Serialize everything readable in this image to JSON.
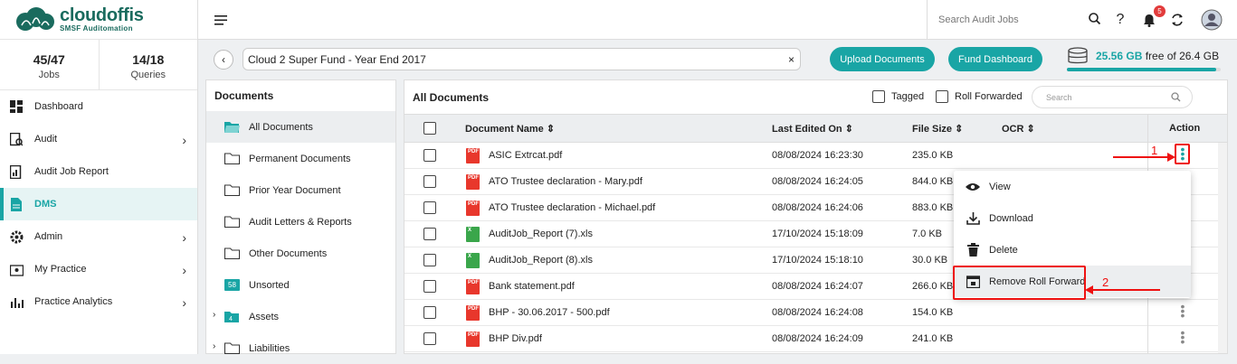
{
  "brand": {
    "title": "cloudoffis",
    "subtitle": "SMSF Auditomation"
  },
  "stats": [
    {
      "value": "45/47",
      "label": "Jobs"
    },
    {
      "value": "14/18",
      "label": "Queries"
    }
  ],
  "nav": [
    {
      "label": "Dashboard",
      "icon": "dashboard-icon"
    },
    {
      "label": "Audit",
      "icon": "audit-icon"
    },
    {
      "label": "Audit Job Report",
      "icon": "report-icon"
    },
    {
      "label": "DMS",
      "icon": "document-icon"
    },
    {
      "label": "Admin",
      "icon": "gear-icon"
    },
    {
      "label": "My Practice",
      "icon": "practice-icon"
    },
    {
      "label": "Practice Analytics",
      "icon": "analytics-icon"
    }
  ],
  "topbar": {
    "search_placeholder": "Search Audit Jobs",
    "notification_count": "5"
  },
  "path": {
    "value": "Cloud 2 Super Fund - Year End 2017",
    "clear": "×"
  },
  "buttons": {
    "upload": "Upload Documents",
    "fund": "Fund Dashboard"
  },
  "storage": {
    "used": "25.56 GB",
    "rest": " free of 26.4 GB",
    "fraction": 0.97
  },
  "folders": {
    "title": "Documents",
    "items": [
      {
        "label": "All Documents"
      },
      {
        "label": "Permanent Documents"
      },
      {
        "label": "Prior Year Document"
      },
      {
        "label": "Audit Letters & Reports"
      },
      {
        "label": "Other Documents"
      },
      {
        "label": "Unsorted",
        "count": "58"
      },
      {
        "label": "Assets"
      },
      {
        "label": "Liabilities"
      }
    ]
  },
  "docs": {
    "title": "All Documents",
    "filter_tagged": "Tagged",
    "filter_rolled": "Roll Forwarded",
    "search_placeholder": "Search",
    "columns": {
      "name": "Document Name",
      "edited": "Last Edited On",
      "size": "File Size",
      "ocr": "OCR",
      "action": "Action"
    },
    "rows": [
      {
        "name": "ASIC Extrcat.pdf",
        "edited": "08/08/2024 16:23:30",
        "size": "235.0 KB",
        "type": "pdf"
      },
      {
        "name": "ATO Trustee declaration - Mary.pdf",
        "edited": "08/08/2024 16:24:05",
        "size": "844.0 KB",
        "type": "pdf"
      },
      {
        "name": "ATO Trustee declaration - Michael.pdf",
        "edited": "08/08/2024 16:24:06",
        "size": "883.0 KB",
        "type": "pdf"
      },
      {
        "name": "AuditJob_Report (7).xls",
        "edited": "17/10/2024 15:18:09",
        "size": "7.0 KB",
        "type": "xls"
      },
      {
        "name": "AuditJob_Report (8).xls",
        "edited": "17/10/2024 15:18:10",
        "size": "30.0 KB",
        "type": "xls"
      },
      {
        "name": "Bank statement.pdf",
        "edited": "08/08/2024 16:24:07",
        "size": "266.0 KB",
        "type": "pdf"
      },
      {
        "name": "BHP - 30.06.2017 - 500.pdf",
        "edited": "08/08/2024 16:24:08",
        "size": "154.0 KB",
        "type": "pdf"
      },
      {
        "name": "BHP Div.pdf",
        "edited": "08/08/2024 16:24:09",
        "size": "241.0 KB",
        "type": "pdf"
      }
    ]
  },
  "menu": [
    {
      "label": "View"
    },
    {
      "label": "Download"
    },
    {
      "label": "Delete"
    },
    {
      "label": "Remove Roll Forward"
    }
  ],
  "annotations": {
    "step1": "1",
    "step2": "2"
  }
}
